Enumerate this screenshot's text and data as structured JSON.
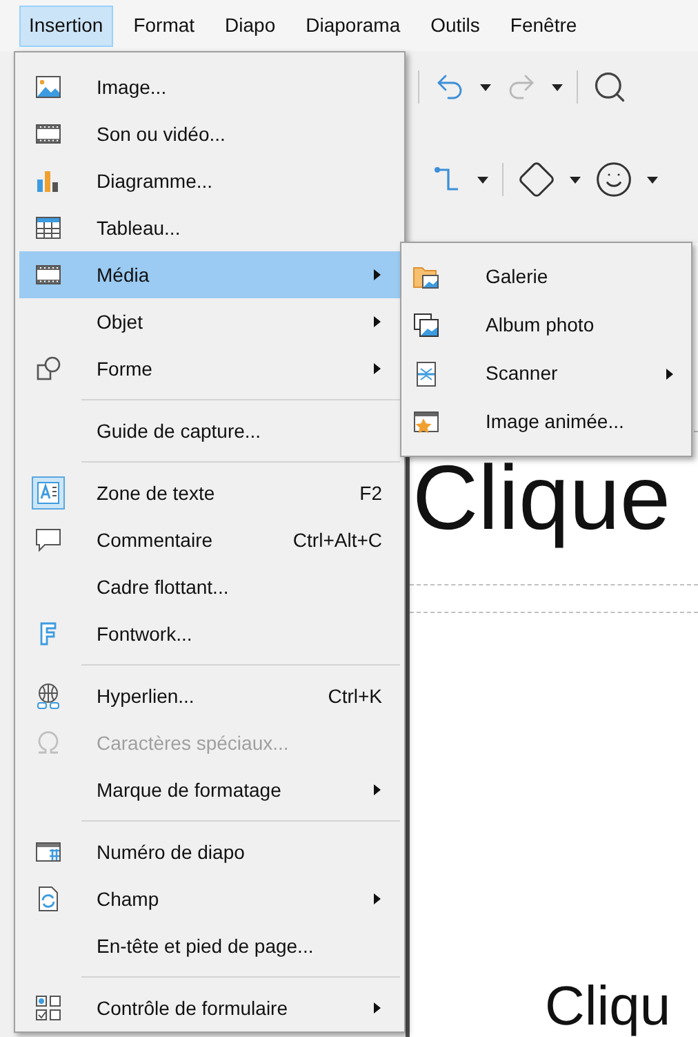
{
  "menu_bar": [
    {
      "label": "Insertion",
      "selected": true
    },
    {
      "label": "Format",
      "selected": false
    },
    {
      "label": "Diapo",
      "selected": false
    },
    {
      "label": "Diaporama",
      "selected": false
    },
    {
      "label": "Outils",
      "selected": false
    },
    {
      "label": "Fenêtre",
      "selected": false
    }
  ],
  "menu": {
    "items": [
      {
        "kind": "item",
        "label": "Image...",
        "selected": false,
        "disabled": false,
        "checked": false,
        "submenu": false
      },
      {
        "kind": "item",
        "label": "Son ou vidéo...",
        "selected": false,
        "disabled": false,
        "checked": false,
        "submenu": false
      },
      {
        "kind": "item",
        "label": "Diagramme...",
        "selected": false,
        "disabled": false,
        "checked": false,
        "submenu": false
      },
      {
        "kind": "item",
        "label": "Tableau...",
        "selected": false,
        "disabled": false,
        "checked": false,
        "submenu": false
      },
      {
        "kind": "item",
        "label": "Média",
        "selected": true,
        "disabled": false,
        "checked": false,
        "submenu": true
      },
      {
        "kind": "item",
        "label": "Objet",
        "selected": false,
        "disabled": false,
        "checked": false,
        "submenu": true
      },
      {
        "kind": "item",
        "label": "Forme",
        "selected": false,
        "disabled": false,
        "checked": false,
        "submenu": true
      },
      {
        "kind": "separator"
      },
      {
        "kind": "item",
        "label": "Guide de capture...",
        "selected": false,
        "disabled": false,
        "checked": false,
        "submenu": false
      },
      {
        "kind": "separator"
      },
      {
        "kind": "item",
        "label": "Zone de texte",
        "shortcut": "F2",
        "selected": false,
        "disabled": false,
        "checked": true,
        "submenu": false
      },
      {
        "kind": "item",
        "label": "Commentaire",
        "shortcut": "Ctrl+Alt+C",
        "selected": false,
        "disabled": false,
        "checked": false,
        "submenu": false
      },
      {
        "kind": "item",
        "label": "Cadre flottant...",
        "selected": false,
        "disabled": false,
        "checked": false,
        "submenu": false
      },
      {
        "kind": "item",
        "label": "Fontwork...",
        "selected": false,
        "disabled": false,
        "checked": false,
        "submenu": false
      },
      {
        "kind": "separator"
      },
      {
        "kind": "item",
        "label": "Hyperlien...",
        "shortcut": "Ctrl+K",
        "selected": false,
        "disabled": false,
        "checked": false,
        "submenu": false
      },
      {
        "kind": "item",
        "label": "Caractères spéciaux...",
        "selected": false,
        "disabled": true,
        "checked": false,
        "submenu": false
      },
      {
        "kind": "item",
        "label": "Marque de formatage",
        "selected": false,
        "disabled": false,
        "checked": false,
        "submenu": true
      },
      {
        "kind": "separator"
      },
      {
        "kind": "item",
        "label": "Numéro de diapo",
        "selected": false,
        "disabled": false,
        "checked": false,
        "submenu": false
      },
      {
        "kind": "item",
        "label": "Champ",
        "selected": false,
        "disabled": false,
        "checked": false,
        "submenu": true
      },
      {
        "kind": "item",
        "label": "En-tête et pied de page...",
        "selected": false,
        "disabled": false,
        "checked": false,
        "submenu": false
      },
      {
        "kind": "separator"
      },
      {
        "kind": "item",
        "label": "Contrôle de formulaire",
        "selected": false,
        "disabled": false,
        "checked": false,
        "submenu": true
      }
    ]
  },
  "submenu": {
    "items": [
      {
        "label": "Galerie",
        "selected": false,
        "submenu": false
      },
      {
        "label": "Album photo",
        "selected": false,
        "submenu": false
      },
      {
        "label": "Scanner",
        "selected": false,
        "submenu": true
      },
      {
        "label": "Image animée...",
        "selected": false,
        "submenu": false
      }
    ]
  },
  "slide": {
    "title_placeholder": "Clique",
    "body_placeholder": "Cliqu"
  }
}
